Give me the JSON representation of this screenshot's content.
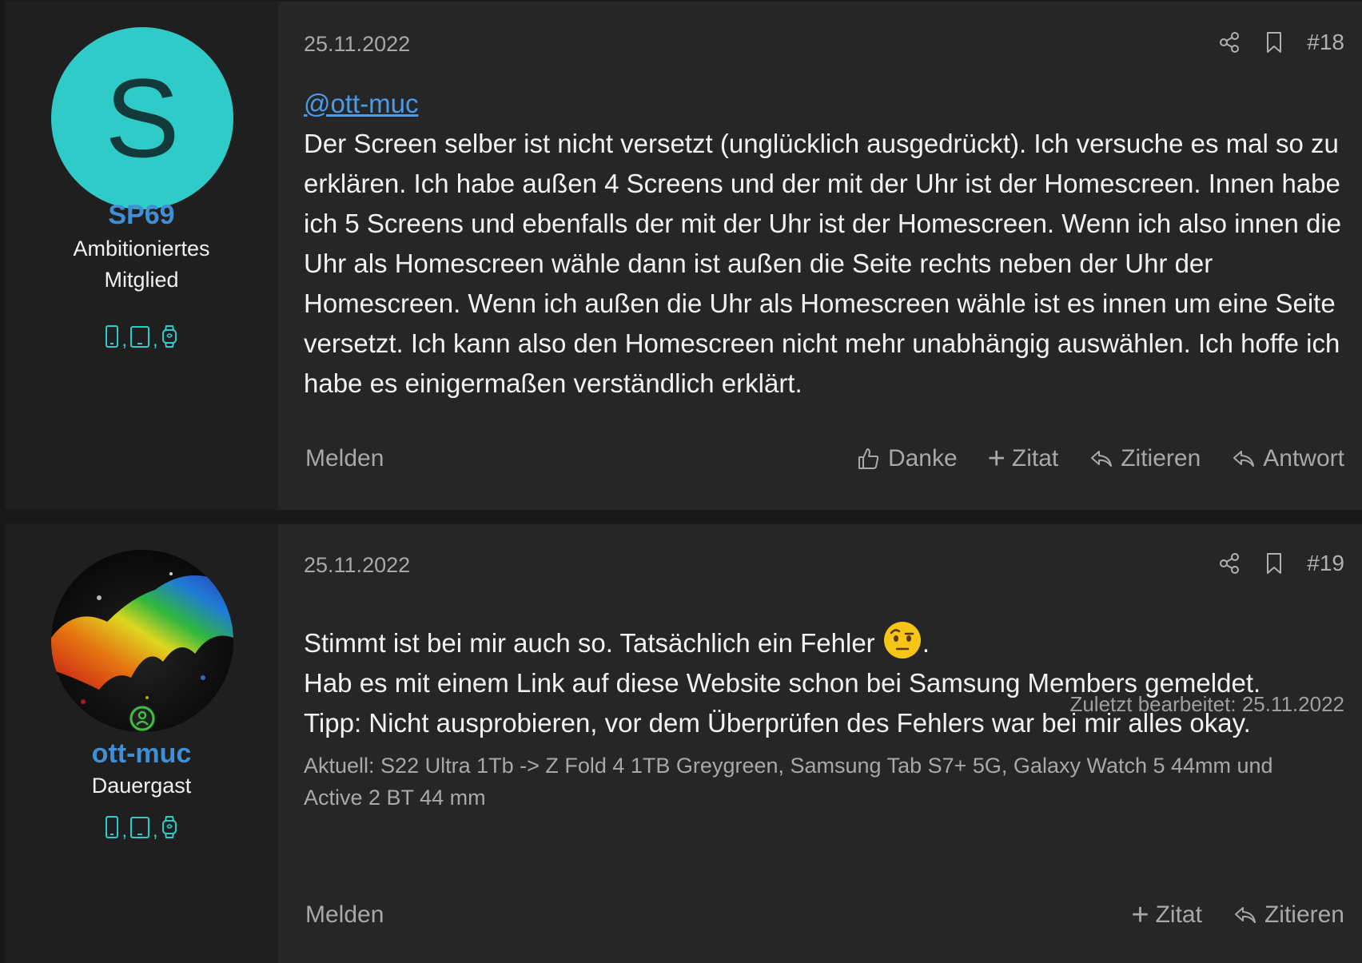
{
  "posts": [
    {
      "author": {
        "avatar_letter": "S",
        "username": "SP69",
        "title": "Ambitioniertes Mitglied"
      },
      "date": "25.11.2022",
      "post_number": "#18",
      "mention": "@ott-muc",
      "body": "Der Screen selber ist nicht versetzt (unglücklich ausgedrückt). Ich versuche es mal so zu erklären. Ich habe außen 4 Screens und der mit der Uhr ist der Homescreen. Innen habe ich 5 Screens und ebenfalls der mit der Uhr ist der Homescreen. Wenn ich also innen die Uhr als Homescreen wähle dann ist außen die Seite rechts neben der Uhr der Homescreen. Wenn ich außen die Uhr als Homescreen wähle ist es innen um eine Seite versetzt. Ich kann also den Homescreen nicht mehr unabhängig auswählen. Ich hoffe ich habe es einigermaßen verständlich erklärt.",
      "footer": {
        "report": "Melden",
        "thanks": "Danke",
        "quote_plus": "Zitat",
        "quote": "Zitieren",
        "reply": "Antwort"
      }
    },
    {
      "author": {
        "username": "ott-muc",
        "title": "Dauergast"
      },
      "date": "25.11.2022",
      "post_number": "#19",
      "body_line1": "Stimmt ist bei mir auch so. Tatsächlich ein Fehler",
      "body_line1_end": ".",
      "body_line2": "Hab es mit einem Link auf diese Website schon bei Samsung Members gemeldet.",
      "body_line3": "Tipp: Nicht ausprobieren, vor dem Überprüfen des Fehlers war bei mir alles okay.",
      "edited": "Zuletzt bearbeitet: 25.11.2022",
      "signature": "Aktuell: S22 Ultra 1Tb -> Z Fold 4 1TB Greygreen, Samsung Tab S7+ 5G, Galaxy Watch 5 44mm und Active 2 BT 44 mm",
      "footer": {
        "report": "Melden",
        "quote_plus": "Zitat",
        "quote": "Zitieren"
      }
    }
  ],
  "colors": {
    "accent": "#3f8fd6",
    "avatar_bg": "#2ecbc8",
    "post_bg": "#262626",
    "user_cell_bg": "#1f1f1f",
    "page_bg": "#181818"
  },
  "icons": [
    "share-icon",
    "bookmark-icon",
    "thumbs-up-icon",
    "plus-icon",
    "reply-icon",
    "phone-icon",
    "tablet-icon",
    "watch-icon",
    "online-status-icon",
    "raised-eyebrow-emoji"
  ]
}
